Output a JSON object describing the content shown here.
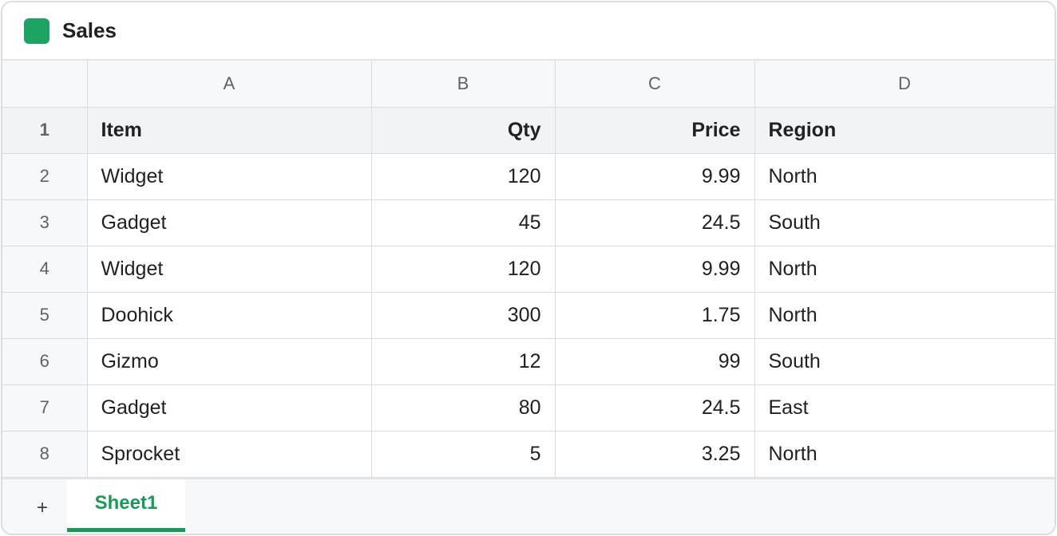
{
  "document": {
    "title": "Sales",
    "icon": "spreadsheet-icon",
    "accent_color": "#1da462"
  },
  "grid": {
    "columns": [
      "A",
      "B",
      "C",
      "D"
    ],
    "row_numbers": [
      "1",
      "2",
      "3",
      "4",
      "5",
      "6",
      "7",
      "8"
    ],
    "rows": [
      [
        "Item",
        "Qty",
        "Price",
        "Region"
      ],
      [
        "Widget",
        "120",
        "9.99",
        "North"
      ],
      [
        "Gadget",
        "45",
        "24.5",
        "South"
      ],
      [
        "Widget",
        "120",
        "9.99",
        "North"
      ],
      [
        "Doohick",
        "300",
        "1.75",
        "North"
      ],
      [
        "Gizmo",
        "12",
        "99",
        "South"
      ],
      [
        "Gadget",
        "80",
        "24.5",
        "East"
      ],
      [
        "Sprocket",
        "5",
        "3.25",
        "North"
      ]
    ]
  },
  "sheets": {
    "add_label": "+",
    "tabs": [
      "Sheet1"
    ],
    "active_color": "#1a9a58"
  }
}
